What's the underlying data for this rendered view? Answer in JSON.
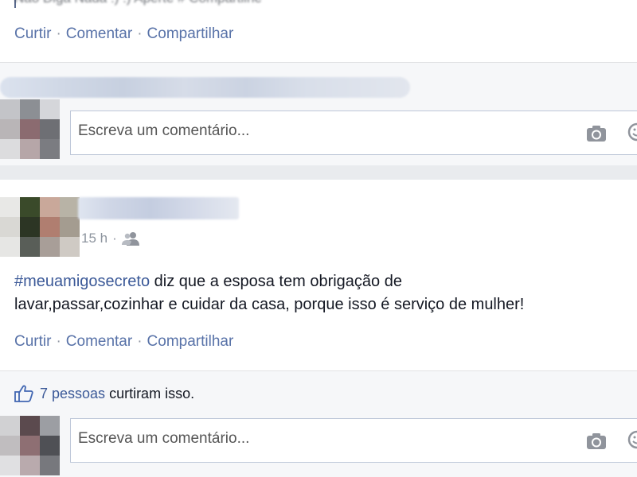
{
  "top_post": {
    "cut_text": "Não Diga Nada :) :) Aperte # Compartilhe",
    "actions": {
      "like": "Curtir",
      "comment": "Comentar",
      "share": "Compartilhar",
      "sep": "·"
    }
  },
  "top_comment": {
    "placeholder": "Escreva um comentário..."
  },
  "post": {
    "time": "15 h",
    "sep": "·",
    "privacy_icon": "friends-icon",
    "hashtag": "#meuamigosecreto",
    "text_line1": " diz que a esposa tem obrigação de",
    "text_line2": "lavar,passar,cozinhar e cuidar da casa, porque isso é serviço de mulher!",
    "actions": {
      "like": "Curtir",
      "comment": "Comentar",
      "share": "Compartilhar",
      "sep": "·"
    }
  },
  "likes": {
    "count": "7 pessoas",
    "rest": "curtiram isso.",
    "icon": "thumbs-up-icon"
  },
  "bottom_comment": {
    "placeholder": "Escreva um comentário..."
  },
  "colors": {
    "link": "#5872a8",
    "hashtag": "#3b5998",
    "background": "#e9ebee"
  }
}
